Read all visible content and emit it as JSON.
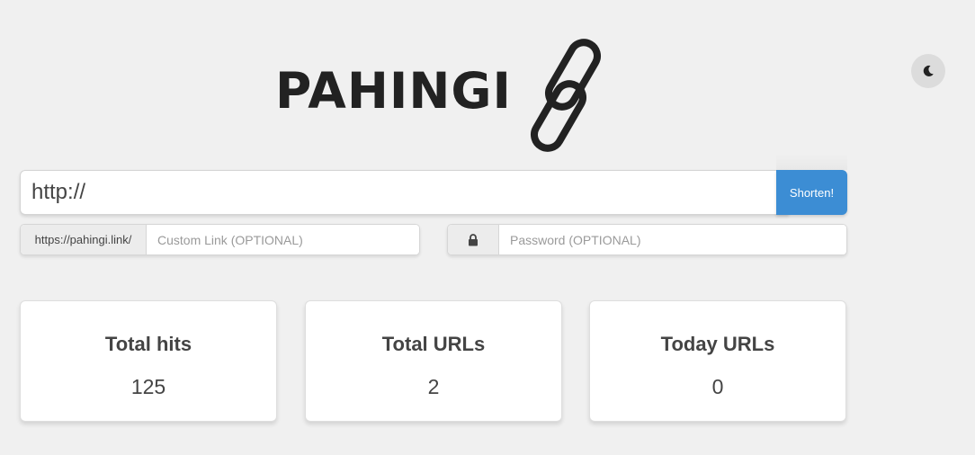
{
  "app": {
    "logo_text": "PAHINGI",
    "accent_color": "#3c8dd4",
    "theme_toggle_icon": "moon-icon"
  },
  "shortener": {
    "url_value": "http://",
    "shorten_label": "Shorten!",
    "custom_prefix": "https://pahingi.link/",
    "custom_placeholder": "Custom Link (OPTIONAL)",
    "password_icon": "lock-icon",
    "password_placeholder": "Password (OPTIONAL)"
  },
  "stats": [
    {
      "title": "Total hits",
      "value": "125"
    },
    {
      "title": "Total URLs",
      "value": "2"
    },
    {
      "title": "Today URLs",
      "value": "0"
    }
  ]
}
